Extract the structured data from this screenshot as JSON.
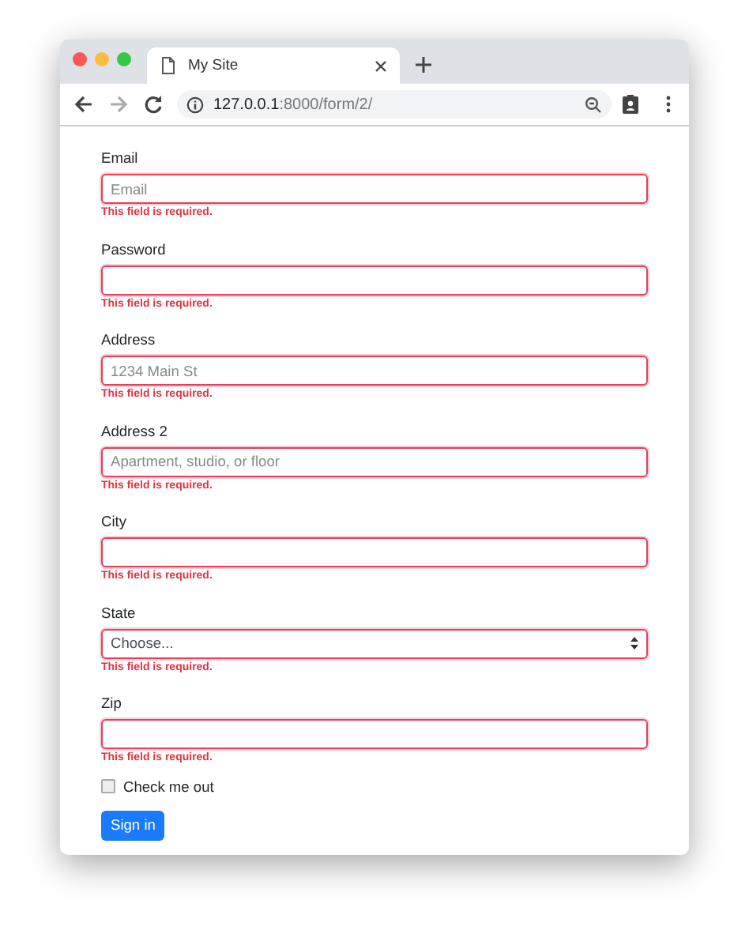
{
  "browser": {
    "tab_title": "My Site",
    "tab_selected": true,
    "url": {
      "host": "127.0.0.1",
      "path": ":8000/form/2/"
    }
  },
  "form": {
    "fields": [
      {
        "kind": "input",
        "label": "Email",
        "placeholder": "Email",
        "invalid": true,
        "error": "This field is required."
      },
      {
        "kind": "input",
        "label": "Password",
        "invalid": true,
        "error": "This field is required."
      },
      {
        "kind": "input",
        "label": "Address",
        "placeholder": "1234 Main St",
        "invalid": true,
        "error": "This field is required."
      },
      {
        "kind": "input",
        "label": "Address 2",
        "placeholder": "Apartment, studio, or floor",
        "invalid": true,
        "error": "This field is required."
      },
      {
        "kind": "input",
        "label": "City",
        "invalid": true,
        "error": "This field is required."
      },
      {
        "kind": "select",
        "label": "State",
        "value": "Choose...",
        "invalid": true,
        "error": "This field is required."
      },
      {
        "kind": "input",
        "label": "Zip",
        "invalid": true,
        "error": "This field is required."
      }
    ],
    "checkbox": {
      "label": "Check me out",
      "checked": false
    },
    "submit": "Sign in"
  }
}
